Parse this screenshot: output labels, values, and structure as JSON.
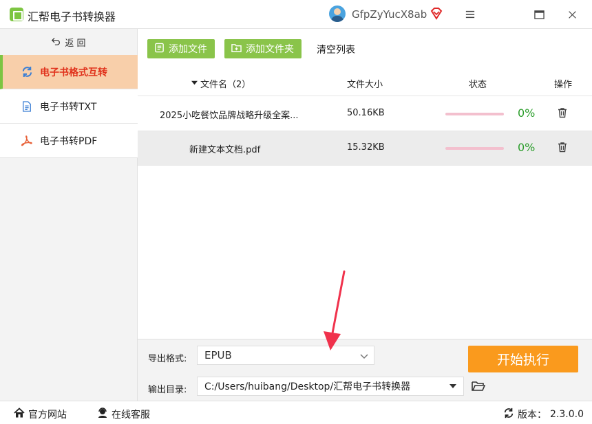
{
  "app": {
    "title": "汇帮电子书转换器",
    "logo_icon": "app-logo-icon"
  },
  "user": {
    "name": "GfpZyYucX8ab",
    "avatar_icon": "user-avatar",
    "vip_icon": "vip-diamond-icon"
  },
  "window_controls": {
    "menu_icon": "hamburger-menu-icon",
    "maximize_icon": "maximize-icon",
    "close_icon": "close-icon"
  },
  "sidebar": {
    "back_label": "返 回",
    "items": [
      {
        "label": "电子书格式互转",
        "icon": "refresh-icon",
        "active": true
      },
      {
        "label": "电子书转TXT",
        "icon": "txt-document-icon",
        "active": false
      },
      {
        "label": "电子书转PDF",
        "icon": "pdf-icon",
        "active": false
      }
    ]
  },
  "toolbar": {
    "add_file_label": "添加文件",
    "add_folder_label": "添加文件夹",
    "clear_label": "清空列表"
  },
  "table": {
    "columns": {
      "name": "文件名（2）",
      "size": "文件大小",
      "status": "状态",
      "ops": "操作"
    },
    "rows": [
      {
        "name": "2025小吃餐饮品牌战略升级全案...",
        "size": "50.16KB",
        "progress": 0,
        "progress_label": "0%"
      },
      {
        "name": "新建文本文档.pdf",
        "size": "15.32KB",
        "progress": 0,
        "progress_label": "0%"
      }
    ]
  },
  "settings": {
    "format_label": "导出格式:",
    "format_value": "EPUB",
    "dir_label": "输出目录:",
    "dir_value": "C:/Users/huibang/Desktop/汇帮电子书转换器",
    "start_label": "开始执行"
  },
  "statusbar": {
    "site_label": "官方网站",
    "support_label": "在线客服",
    "version_label": "版本：",
    "version_value": "2.3.0.0"
  },
  "colors": {
    "accent_green": "#8ac44a",
    "active_bg": "#f8cfaa",
    "active_text": "#e0311b",
    "start_orange": "#fa9a1d",
    "progress_green": "#2a9d2a"
  }
}
